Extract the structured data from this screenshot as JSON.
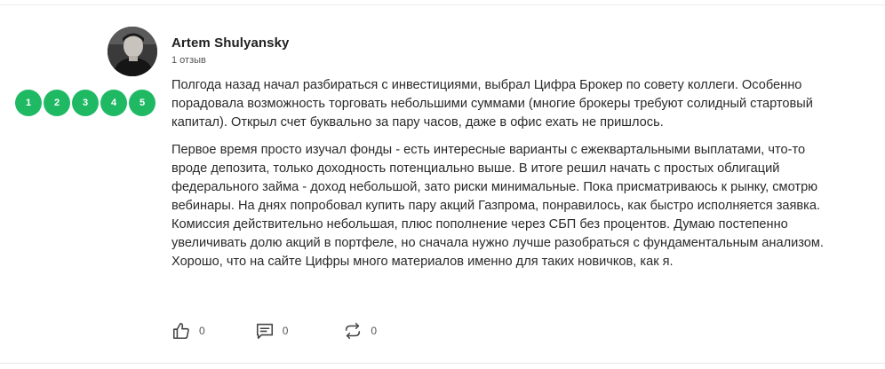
{
  "author": {
    "name": "Artem Shulyansky",
    "reviews_count": "1 отзыв"
  },
  "rating": {
    "options": [
      "1",
      "2",
      "3",
      "4",
      "5"
    ],
    "color": "#1fb964"
  },
  "review": {
    "paragraphs": [
      "Полгода назад начал разбираться с инвестициями, выбрал Цифра Брокер по совету коллеги. Особенно порадовала возможность торговать небольшими суммами (многие брокеры требуют солидный стартовый капитал). Открыл счет буквально за пару часов, даже в офис ехать не пришлось.",
      "Первое время просто изучал фонды - есть интересные варианты с ежеквартальными выплатами, что-то вроде депозита, только доходность потенциально выше. В итоге решил начать с простых облигаций федерального займа - доход небольшой, зато риски минимальные. Пока присматриваюсь к рынку, смотрю вебинары. На днях попробовал купить пару акций Газпрома, понравилось, как быстро исполняется заявка. Комиссия действительно небольшая, плюс пополнение через СБП без процентов. Думаю постепенно увеличивать долю акций в портфеле, но сначала нужно лучше разобраться с фундаментальным анализом. Хорошо, что на сайте Цифры много материалов именно для таких новичков, как я."
    ]
  },
  "actions": {
    "likes": "0",
    "comments": "0",
    "reposts": "0"
  }
}
